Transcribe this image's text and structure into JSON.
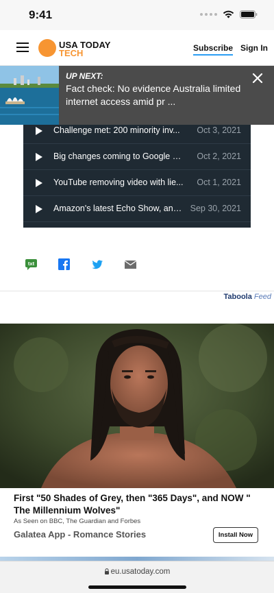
{
  "status_bar": {
    "time": "9:41"
  },
  "header": {
    "logo_line1": "USA TODAY",
    "logo_line2": "TECH",
    "subscribe_label": "Subscribe",
    "signin_label": "Sign In"
  },
  "up_next": {
    "label": "UP NEXT:",
    "title": "Fact check: No evidence Australia limited internet access amid pr ..."
  },
  "playlist": {
    "items": [
      {
        "title": "Challenge met: 200 minority inv...",
        "date": "Oct 3, 2021"
      },
      {
        "title": "Big changes coming to Google s...",
        "date": "Oct 2, 2021"
      },
      {
        "title": "YouTube removing video with lie...",
        "date": "Oct 1, 2021"
      },
      {
        "title": "Amazon's latest Echo Show, and...",
        "date": "Sep 30, 2021"
      }
    ]
  },
  "share": {
    "items": [
      {
        "icon": "sms-txt-icon",
        "glyph": "txt",
        "color": "#3a8f3a"
      },
      {
        "icon": "facebook-icon",
        "color": "#1877f2"
      },
      {
        "icon": "twitter-icon",
        "color": "#1da1f2"
      },
      {
        "icon": "email-icon",
        "color": "#6b6b6b"
      }
    ]
  },
  "taboola": {
    "brand": "Taboola",
    "feed": "Feed"
  },
  "ad": {
    "title": "First \"50 Shades of Grey, then \"365 Days\", and NOW \" The Millennium Wolves\"",
    "source": "As Seen on BBC, The Guardian and Forbes",
    "brand": "Galatea App - Romance Stories",
    "cta": "Install Now"
  },
  "browser": {
    "url": "eu.usatoday.com"
  },
  "colors": {
    "accent": "#f79532",
    "player_bg": "#1f2a33",
    "upnext_bg": "#4b4b4b",
    "subscribe_underline": "#2a9df4"
  }
}
